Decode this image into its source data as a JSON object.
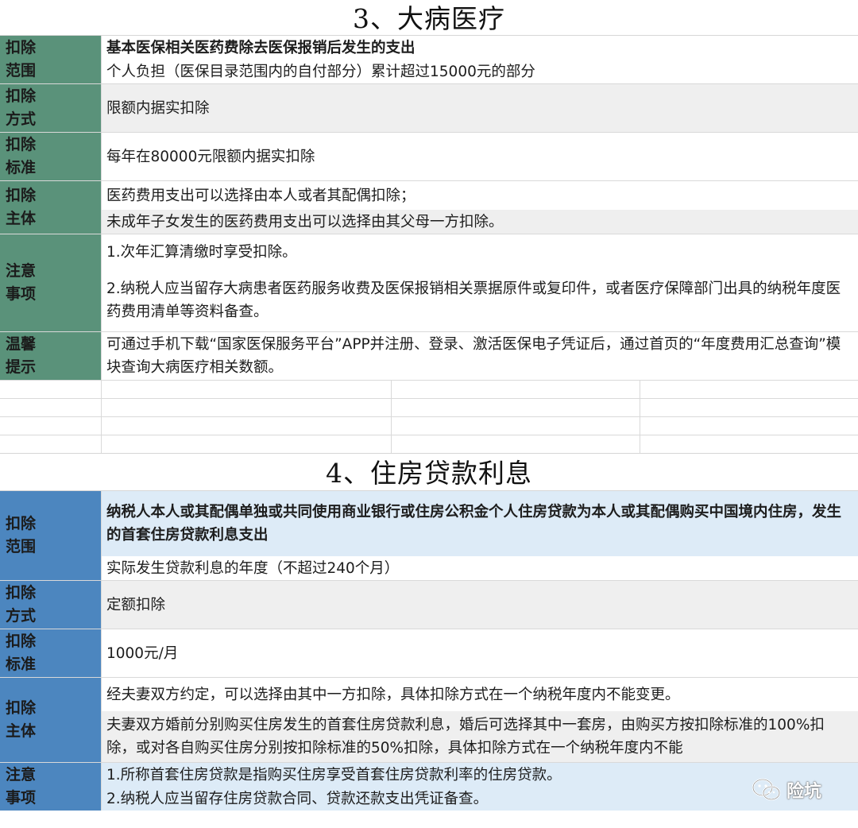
{
  "section3": {
    "title": "3、大病医疗",
    "rows": [
      {
        "label": "扣除\n范围",
        "lines": [
          "基本医保相关医药费除去医保报销后发生的支出",
          "个人负担（医保目录范围内的自付部分）累计超过15000元的部分"
        ]
      },
      {
        "label": "扣除\n方式",
        "lines": [
          "限额内据实扣除"
        ]
      },
      {
        "label": "扣除\n标准",
        "lines": [
          "每年在80000元限额内据实扣除"
        ]
      },
      {
        "label": "扣除\n主体",
        "lines": [
          "医药费用支出可以选择由本人或者其配偶扣除；",
          "未成年子女发生的医药费用支出可以选择由其父母一方扣除。"
        ]
      },
      {
        "label": "注意\n事项",
        "lines": [
          "1.次年汇算清缴时享受扣除。",
          "2.纳税人应当留存大病患者医药服务收费及医保报销相关票据原件或复印件，或者医疗保障部门出具的纳税年度医药费用清单等资料备查。"
        ]
      },
      {
        "label": "温馨\n提示",
        "lines": [
          "可通过手机下载“国家医保服务平台”APP并注册、登录、激活医保电子凭证后，通过首页的“年度费用汇总查询”模块查询大病医疗相关数额。"
        ]
      }
    ]
  },
  "section4": {
    "title": "4、住房贷款利息",
    "rows": [
      {
        "label": "扣除\n范围",
        "lines": [
          "纳税人本人或其配偶单独或共同使用商业银行或住房公积金个人住房贷款为本人或其配偶购买中国境内住房，发生的首套住房贷款利息支出",
          "实际发生贷款利息的年度（不超过240个月）"
        ]
      },
      {
        "label": "扣除\n方式",
        "lines": [
          "定额扣除"
        ]
      },
      {
        "label": "扣除\n标准",
        "lines": [
          "1000元/月"
        ]
      },
      {
        "label": "扣除\n主体",
        "lines": [
          "经夫妻双方约定，可以选择由其中一方扣除，具体扣除方式在一个纳税年度内不能变更。",
          "夫妻双方婚前分别购买住房发生的首套住房贷款利息，婚后可选择其中一套房，由购买方按扣除标准的100%扣除，或对各自购买住房分别按扣除标准的50%扣除，具体扣除方式在一个纳税年度内不能"
        ]
      },
      {
        "label": "注意\n事项",
        "lines": [
          "1.所称首套住房贷款是指购买住房享受首套住房贷款利率的住房贷款。",
          "2.纳税人应当留存住房贷款合同、贷款还款支出凭证备查。"
        ]
      }
    ]
  },
  "watermark": {
    "text": "险坑",
    "icon": "wechat-icon"
  },
  "colors": {
    "label_green": "#5a927a",
    "label_blue": "#4c86bf",
    "row_gray": "#efefef",
    "row_blue": "#ddebf7"
  }
}
